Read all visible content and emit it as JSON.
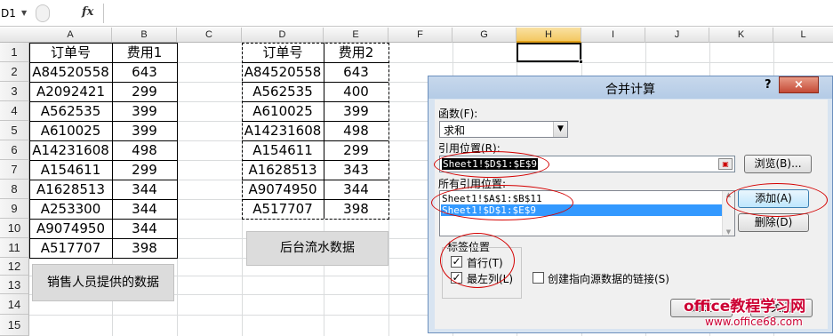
{
  "formula_bar": {
    "name_box": "D1",
    "fx": "fx",
    "formula": ""
  },
  "columns": [
    "A",
    "B",
    "C",
    "D",
    "E",
    "F",
    "G",
    "H",
    "I",
    "J",
    "K",
    "L"
  ],
  "rows": [
    "1",
    "2",
    "3",
    "4",
    "5",
    "6",
    "7",
    "8",
    "9",
    "10",
    "11",
    "12",
    "13",
    "14",
    "15"
  ],
  "table1": {
    "headers": [
      "订单号",
      "费用1"
    ],
    "rows": [
      [
        "A84520558",
        "643"
      ],
      [
        "A2092421",
        "299"
      ],
      [
        "A562535",
        "399"
      ],
      [
        "A610025",
        "399"
      ],
      [
        "A14231608",
        "498"
      ],
      [
        "A154611",
        "299"
      ],
      [
        "A1628513",
        "344"
      ],
      [
        "A253300",
        "344"
      ],
      [
        "A9074950",
        "344"
      ],
      [
        "A517707",
        "398"
      ]
    ]
  },
  "table2": {
    "headers": [
      "订单号",
      "费用2"
    ],
    "rows": [
      [
        "A84520558",
        "643"
      ],
      [
        "A562535",
        "400"
      ],
      [
        "A610025",
        "399"
      ],
      [
        "A14231608",
        "498"
      ],
      [
        "A154611",
        "299"
      ],
      [
        "A1628513",
        "343"
      ],
      [
        "A9074950",
        "344"
      ],
      [
        "A517707",
        "398"
      ]
    ]
  },
  "buttons": {
    "sales_data": "销售人员提供的数据",
    "backend_data": "后台流水数据"
  },
  "dialog": {
    "title": "合并计算",
    "help": "?",
    "close": "×",
    "function_label": "函数(F):",
    "function_value": "求和",
    "reference_label": "引用位置(R):",
    "reference_value": "Sheet1!$D$1:$E$9",
    "browse": "浏览(B)...",
    "all_refs_label": "所有引用位置:",
    "all_refs": [
      "Sheet1!$A$1:$B$11",
      "Sheet1!$D$1:$E$9"
    ],
    "add": "添加(A)",
    "delete": "删除(D)",
    "label_position": "标签位置",
    "top_row": "首行(T)",
    "left_column": "最左列(L)",
    "create_links": "创建指向源数据的链接(S)",
    "ok": "确定",
    "close_btn": "关闭"
  },
  "watermark": {
    "line1": "office教程学习网",
    "line2": "www.office68.com"
  }
}
